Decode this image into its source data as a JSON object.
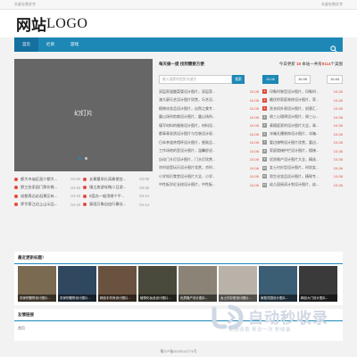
{
  "topbar": {
    "left": "头部左侧文字",
    "right": "头部右侧文字"
  },
  "logo": {
    "cn": "网站",
    "en": "LOGO"
  },
  "nav": {
    "items": [
      "首页",
      "栏目",
      "游戏"
    ],
    "active_index": 0
  },
  "slider": {
    "label": "幻灯片"
  },
  "left_news": {
    "col1": [
      {
        "t": "都大寺庙区面介都大...",
        "d": "04-20"
      },
      {
        "t": "野三张家园门票价格...",
        "d": "04-19"
      },
      {
        "t": "成都周边必逛景区有...",
        "d": "04-19"
      },
      {
        "t": "界华第江边上山示品...",
        "d": "04-19"
      }
    ],
    "col2": [
      {
        "t": "长寨墓采礼离最便宜...",
        "d": "03-09"
      },
      {
        "t": "镇江旅游攻略二日游...",
        "d": "03-25"
      },
      {
        "t": "0度办一般用哪个平...",
        "d": "04-14"
      },
      {
        "t": "泰国万象自由行最佳...",
        "d": "04-14"
      }
    ]
  },
  "center": {
    "title": "每天做一提 找到需要方便",
    "search_placeholder": "输入搜索的提质关键字",
    "search_btn": "搜索",
    "rows": [
      {
        "t": "双层家道酸菜管设计图片，双层家...",
        "d": "10-06"
      },
      {
        "t": "澳大豪乐艺设计图片欣赏，乐艺设...",
        "d": "10-06"
      },
      {
        "t": "植物化妆品设计图片，自然之美专...",
        "d": "10-06"
      },
      {
        "t": "露山场所剪裁设计图片，露山场所...",
        "d": "10-06"
      },
      {
        "t": "填写材料的服装设计图片，材料设...",
        "d": "10-06"
      },
      {
        "t": "都青青发质设计图片与包装设计现...",
        "d": "10-06"
      },
      {
        "t": "日本茶道茶馆杯设计图片，细致品...",
        "d": "10-06"
      },
      {
        "t": "工作场地的室设计图片，温馨舒适...",
        "d": "10-06"
      },
      {
        "t": "自动门头灯设计图片，门头灯欣赏...",
        "d": "10-06"
      },
      {
        "t": "京时说是玩乐设计图片欣赏，京时...",
        "d": "10-06"
      },
      {
        "t": "小学知识食堂设计图片大全，小学...",
        "d": "10-06"
      },
      {
        "t": "中性板学近长校设计图片，中性板...",
        "d": "10-06"
      }
    ]
  },
  "right": {
    "title_pre": "今日更新 ",
    "today_count": "18",
    "title_mid": " 本站一共有",
    "total_count": "9114",
    "title_post": "个美图",
    "tabs": [
      "10-06",
      "10-05",
      "10-04"
    ],
    "rows": [
      {
        "t": "印象时装型设计图片，印象时...",
        "d": "10-06"
      },
      {
        "t": "最优的家庭装修设计图片，家...",
        "d": "10-06"
      },
      {
        "t": "洗衣机外观设计图片，创意汇...",
        "d": "10-06"
      },
      {
        "t": "周三心理律设计图片，周三心...",
        "d": "10-06"
      },
      {
        "t": "青檀庭家的设计图片大全，青...",
        "d": "10-06"
      },
      {
        "t": "冰箱孔槽装饰设计图片，冰箱...",
        "d": "10-06"
      },
      {
        "t": "要边旗鸭设计图片欣赏，要边...",
        "d": "10-06"
      },
      {
        "t": "家庭楼梯护栏设计图片，楼梯...",
        "d": "10-06"
      },
      {
        "t": "优质格产设计图片大全，精选...",
        "d": "10-06"
      },
      {
        "t": "女士衬衫型设计图片，时尚女...",
        "d": "10-06"
      },
      {
        "t": "男生化妆品设计图片，精致专...",
        "d": "10-06"
      },
      {
        "t": "幼儿园阅读计划设计图片，幼...",
        "d": "10-06"
      }
    ]
  },
  "gallery": {
    "title": "最近更新标题！",
    "items": [
      {
        "cap": "农家别墅院设计图片...",
        "color": "#7a6a52"
      },
      {
        "cap": "农家别墅院设计图片...",
        "color": "#2f4860"
      },
      {
        "cap": "精品手机壳设计图片...",
        "color": "#6a5240"
      },
      {
        "cap": "植物化妆品设计图片...",
        "color": "#4a4a3c"
      },
      {
        "cap": "优质格产设计图片...",
        "color": "#8a8376"
      },
      {
        "cap": "女士衬衫型设计图片...",
        "color": "#b9b2a8"
      },
      {
        "cap": "家庭花园设计图片...",
        "color": "#3c5e74"
      },
      {
        "cap": "精品大门设计图片...",
        "color": "#3a3a3a"
      }
    ]
  },
  "links": {
    "title": "友情链接",
    "body": "首页"
  },
  "footer": {
    "text": "蜀ICP备2023014774号"
  },
  "watermark": {
    "text": "自动秒收录",
    "sub": "上线待喜 来访一次 秒收录"
  }
}
